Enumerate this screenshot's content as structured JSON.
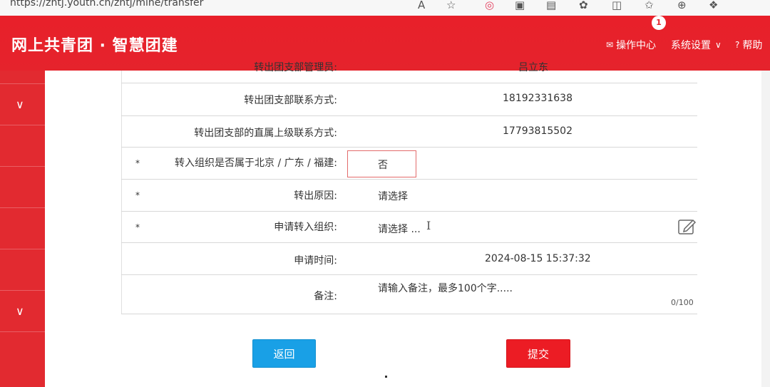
{
  "browser": {
    "url": "https://zhtj.youth.cn/zhtj/mine/transfer",
    "icons": [
      "read-aloud-icon",
      "favorite-star-icon",
      "extension-icon",
      "tab-groups-icon",
      "collections-icon",
      "settings-icon",
      "split-screen-icon",
      "favorites-icon",
      "browser-essentials-icon",
      "copilot-icon"
    ]
  },
  "header": {
    "brand": "网上共青团 · 智慧团建",
    "ops_center": "操作中心",
    "ops_badge": "1",
    "settings": "系统设置",
    "help": "帮助"
  },
  "form": {
    "rows": [
      {
        "label": "转出团支部管理员:",
        "value": "吕立东",
        "required": false
      },
      {
        "label": "转出团支部联系方式:",
        "value": "18192331638",
        "required": false
      },
      {
        "label": "转出团支部的直属上级联系方式:",
        "value": "17793815502",
        "required": false
      },
      {
        "label": "转入组织是否属于北京 / 广东 / 福建:",
        "value": "否",
        "required": true
      },
      {
        "label": "转出原因:",
        "value": "请选择",
        "required": true
      },
      {
        "label": "申请转入组织:",
        "value": "请选择 ...",
        "required": true
      },
      {
        "label": "申请时间:",
        "value": "2024-08-15 15:37:32",
        "required": false
      },
      {
        "label": "备注:",
        "value": "",
        "required": false
      }
    ],
    "required_mark": "*",
    "remark_placeholder": "请输入备注，最多100个字.....",
    "remark_counter": "0/100"
  },
  "buttons": {
    "back": "返回",
    "submit": "提交"
  },
  "colors": {
    "header_red": "#e5232c",
    "sidebar_red": "#e22a30",
    "back_blue": "#19a0e6",
    "submit_red": "#ec1c24"
  }
}
